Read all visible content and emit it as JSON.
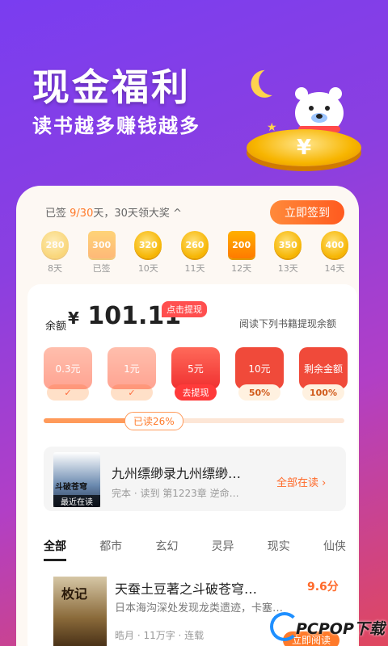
{
  "hero": {
    "title": "现金福利",
    "subtitle": "读书越多赚钱越多",
    "coin_symbol": "¥"
  },
  "signin": {
    "prefix": "已签",
    "count": "9/30",
    "suffix": "天，30天领大奖",
    "chevron": "^",
    "button": "立即签到"
  },
  "days": [
    {
      "amount": "280",
      "label": "8天",
      "state": "faded"
    },
    {
      "amount": "300",
      "label": "已签",
      "state": "faded-box"
    },
    {
      "amount": "320",
      "label": "10天",
      "state": "normal"
    },
    {
      "amount": "260",
      "label": "11天",
      "state": "normal"
    },
    {
      "amount": "200",
      "label": "12天",
      "state": "box"
    },
    {
      "amount": "350",
      "label": "13天",
      "state": "normal"
    },
    {
      "amount": "400",
      "label": "14天",
      "state": "normal"
    }
  ],
  "balance": {
    "label": "余额",
    "currency": "¥",
    "value": "101.11",
    "withdraw_tag": "点击提现",
    "hint": "阅读下列书籍提现余额"
  },
  "packs": [
    {
      "amount": "0.3元",
      "footer": "✓"
    },
    {
      "amount": "1元",
      "footer": "✓"
    },
    {
      "amount": "5元",
      "footer": "去提现"
    },
    {
      "amount": "10元",
      "footer": "50%"
    },
    {
      "amount": "剩余金额",
      "footer": "100%"
    }
  ],
  "progress": {
    "label": "已读26%",
    "fraction": 0.3
  },
  "recent": {
    "cover_tag": "最近在读",
    "cover_text": "斗破苍穹",
    "title": "九州缥缈录九州缥缈…",
    "meta": "完本 · 读到  第1223章  逆命…",
    "more": "全部在读 ›"
  },
  "tabs": [
    "全部",
    "都市",
    "玄幻",
    "灵异",
    "现实",
    "仙侠"
  ],
  "book": {
    "cover_text": "枚记",
    "title": "天蚕土豆著之斗破苍穹…",
    "score": "9.6分",
    "desc": "日本海沟深处发现龙类遗迹，卡塞…",
    "meta": "晧月 · 11万字 · 连载"
  },
  "watermark": {
    "text": "PCPOP下载",
    "button": "立即阅读"
  }
}
